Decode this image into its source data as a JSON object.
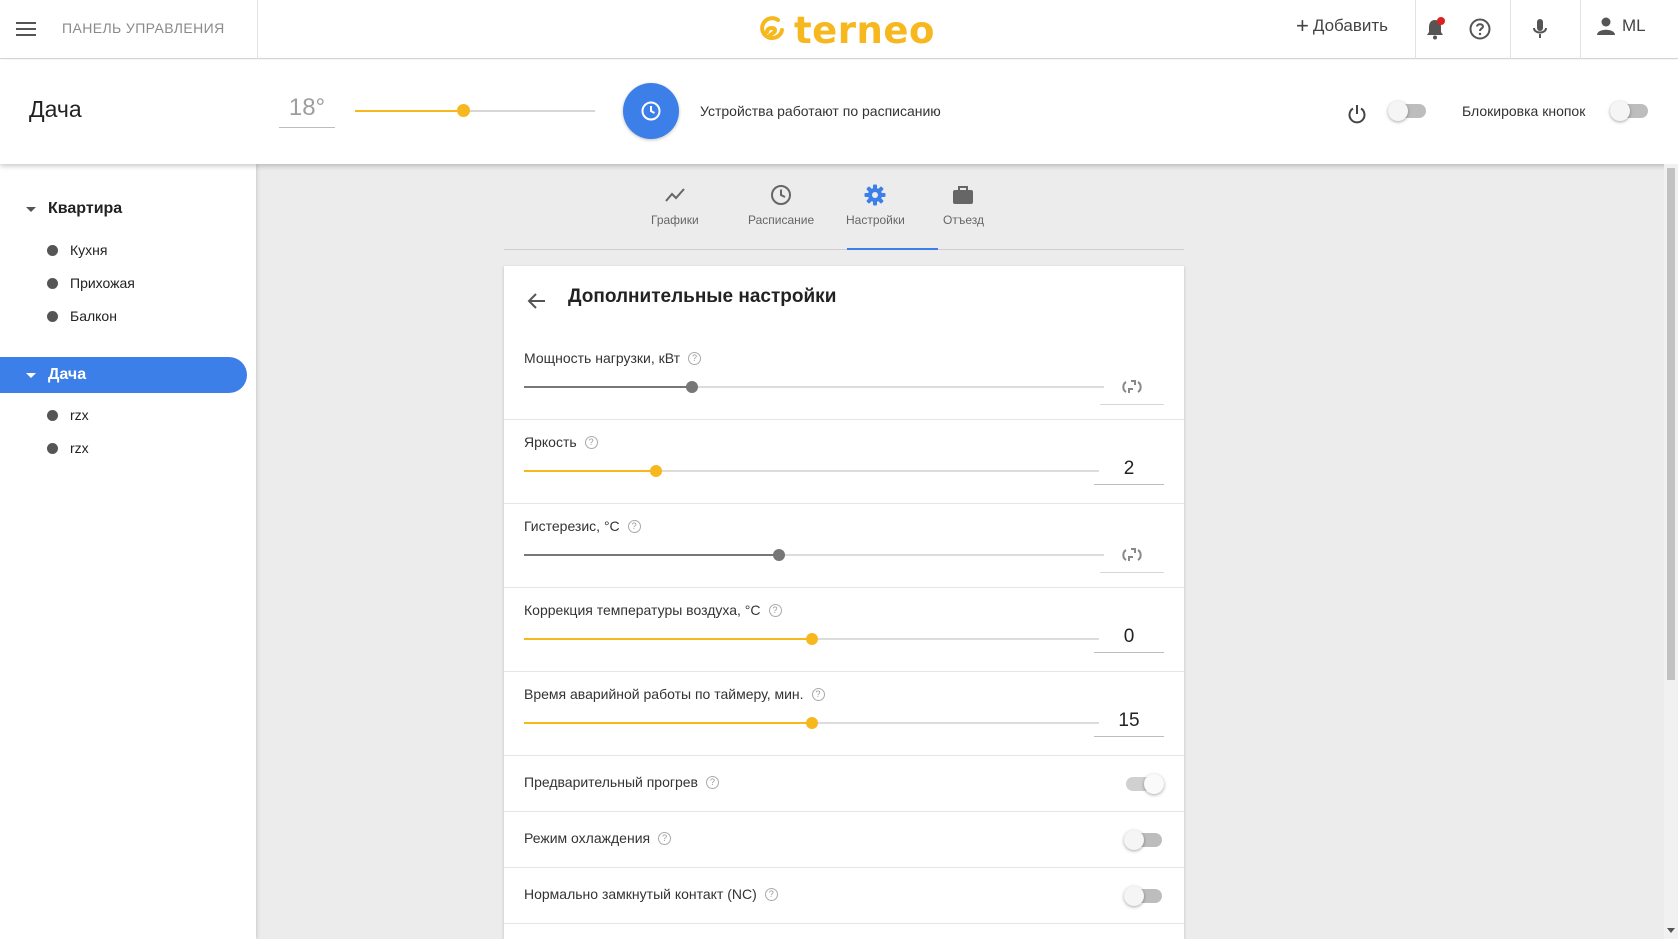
{
  "topbar": {
    "menu_icon": "menu-icon",
    "panel_title": "ПАНЕЛЬ УПРАВЛЕНИЯ",
    "logo_text": "terneo",
    "add_label": "Добавить",
    "user_initials": "ML",
    "notification_badge_color": "#e02020"
  },
  "group": {
    "name": "Дача",
    "temperature": "18°",
    "setpoint_level": 0.45,
    "schedule_text": "Устройства работают по расписанию",
    "power_on": false,
    "lock_label": "Блокировка кнопок",
    "lock_on": false
  },
  "sidebar": {
    "groups": [
      {
        "label": "Квартира",
        "active": false,
        "items": [
          "Кухня",
          "Прихожая",
          "Балкон"
        ]
      },
      {
        "label": "Дача",
        "active": true,
        "items": [
          "rzx",
          "rzx"
        ]
      }
    ]
  },
  "tabs": [
    {
      "label": "Графики",
      "icon": "chart-icon",
      "active": false
    },
    {
      "label": "Расписание",
      "icon": "clock-icon",
      "active": false
    },
    {
      "label": "Настройки",
      "icon": "gear-icon",
      "active": true
    },
    {
      "label": "Отъезд",
      "icon": "briefcase-icon",
      "active": false
    }
  ],
  "settings": {
    "title": "Дополнительные настройки",
    "rows": [
      {
        "label": "Мощность нагрузки, кВт",
        "level": 0.29,
        "value": "",
        "auto": true
      },
      {
        "label": "Яркость",
        "level": 0.23,
        "value": "2",
        "auto": false
      },
      {
        "label": "Гистерезис, °C",
        "level": 0.44,
        "value": "",
        "auto": true
      },
      {
        "label": "Коррекция температуры воздуха, °C",
        "level": 0.5,
        "value": "0",
        "auto": false
      },
      {
        "label": "Время аварийной работы по таймеру, мин.",
        "level": 0.5,
        "value": "15",
        "auto": false
      }
    ],
    "toggles": [
      {
        "label": "Предварительный прогрев",
        "on": true
      },
      {
        "label": "Режим охлаждения",
        "on": false
      },
      {
        "label": "Нормально замкнутый контакт (NC)",
        "on": false
      }
    ]
  },
  "colors": {
    "accent": "#3d7fe8",
    "brand": "#f6b81e",
    "background": "#ececec"
  }
}
